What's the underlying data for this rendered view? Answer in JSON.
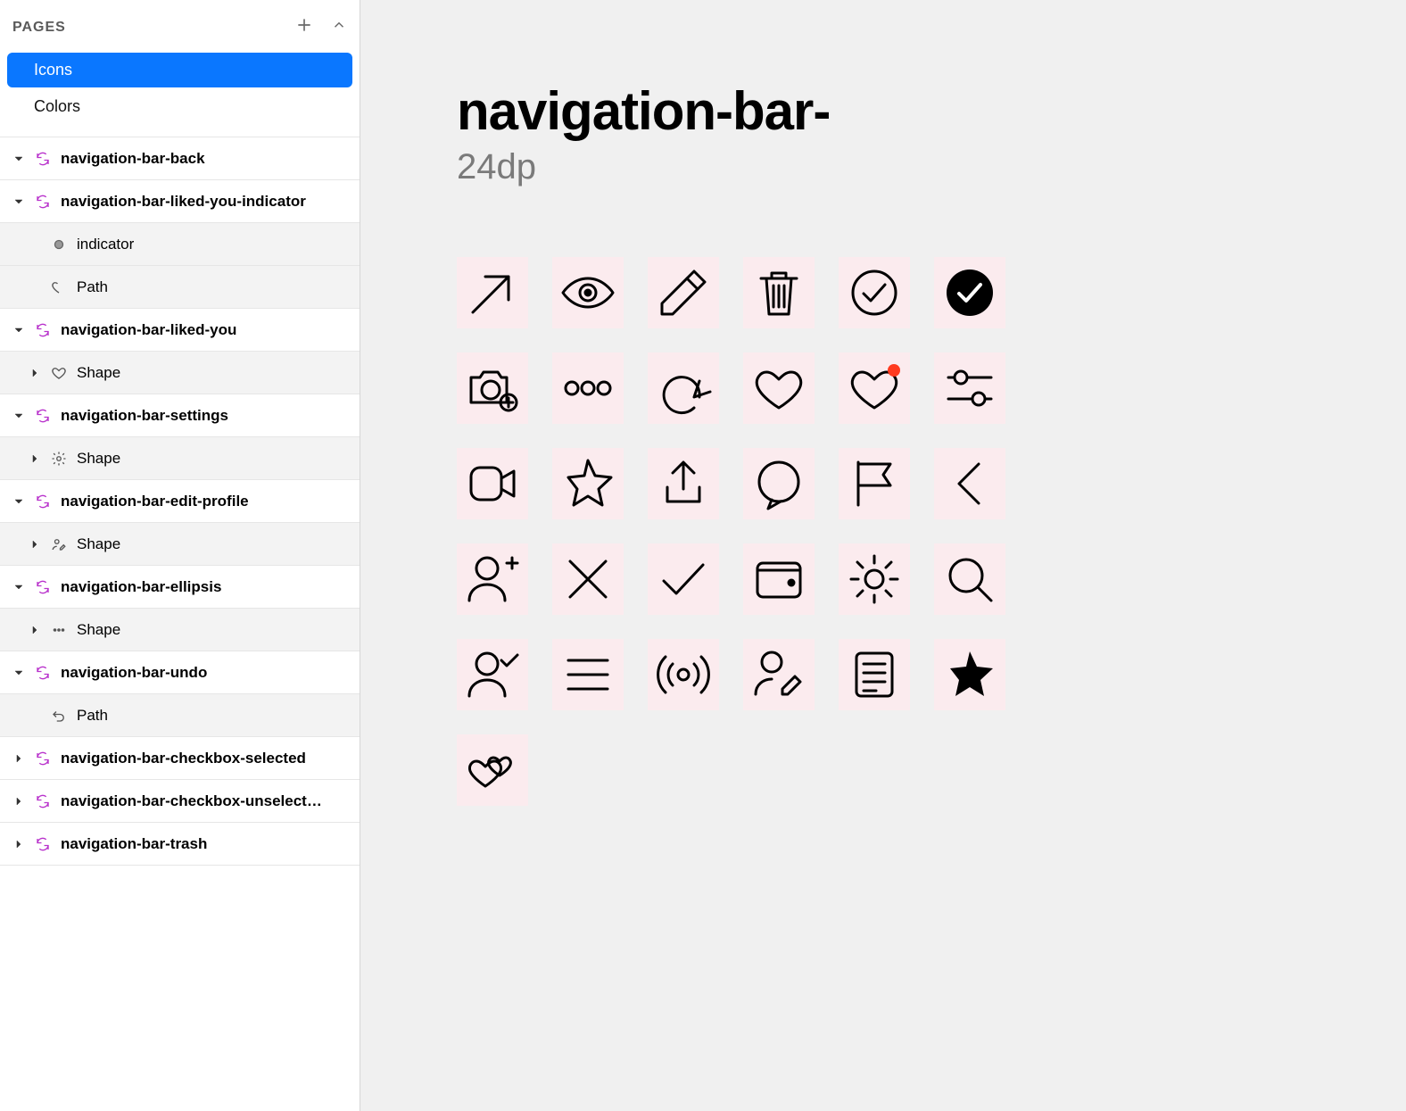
{
  "sidebar": {
    "header_label": "PAGES",
    "pages": [
      {
        "name": "Icons",
        "selected": true
      },
      {
        "name": "Colors",
        "selected": false
      }
    ],
    "layers": [
      {
        "type": "group",
        "open": true,
        "symbol": "sync",
        "label": "navigation-bar-back"
      },
      {
        "type": "group",
        "open": true,
        "symbol": "sync",
        "label": "navigation-bar-liked-you-indicator"
      },
      {
        "type": "child",
        "symbol": "dot",
        "label": "indicator"
      },
      {
        "type": "child",
        "symbol": "path-heart",
        "label": "Path"
      },
      {
        "type": "group",
        "open": true,
        "symbol": "sync",
        "label": "navigation-bar-liked-you"
      },
      {
        "type": "child",
        "open": false,
        "symbol": "heart",
        "label": "Shape"
      },
      {
        "type": "group",
        "open": true,
        "symbol": "sync",
        "label": "navigation-bar-settings"
      },
      {
        "type": "child",
        "open": false,
        "symbol": "gear",
        "label": "Shape"
      },
      {
        "type": "group",
        "open": true,
        "symbol": "sync",
        "label": "navigation-bar-edit-profile"
      },
      {
        "type": "child",
        "open": false,
        "symbol": "user-edit",
        "label": "Shape"
      },
      {
        "type": "group",
        "open": true,
        "symbol": "sync",
        "label": "navigation-bar-ellipsis"
      },
      {
        "type": "child",
        "open": false,
        "symbol": "ellipsis",
        "label": "Shape"
      },
      {
        "type": "group",
        "open": true,
        "symbol": "sync",
        "label": "navigation-bar-undo"
      },
      {
        "type": "child",
        "symbol": "undo",
        "label": "Path"
      },
      {
        "type": "group",
        "open": false,
        "symbol": "sync",
        "label": "navigation-bar-checkbox-selected"
      },
      {
        "type": "group",
        "open": false,
        "symbol": "sync",
        "label": "navigation-bar-checkbox-unselect…"
      },
      {
        "type": "group",
        "open": false,
        "symbol": "sync",
        "label": "navigation-bar-trash"
      }
    ]
  },
  "canvas": {
    "title": "navigation-bar-",
    "subtitle": "24dp",
    "slice_bg": "#fbebee",
    "icons": [
      "arrow-cursor",
      "eye",
      "pencil",
      "trash",
      "circle-check",
      "circle-check-filled",
      "camera-plus",
      "ellipsis",
      "undo",
      "heart",
      "heart-indicator",
      "sliders",
      "video",
      "star",
      "share",
      "chat-bubble",
      "flag",
      "chevron-left",
      "user-plus",
      "x",
      "check",
      "wallet",
      "gear",
      "search",
      "user-check",
      "menu",
      "broadcast",
      "user-edit",
      "document",
      "star-filled",
      "hearts"
    ]
  }
}
